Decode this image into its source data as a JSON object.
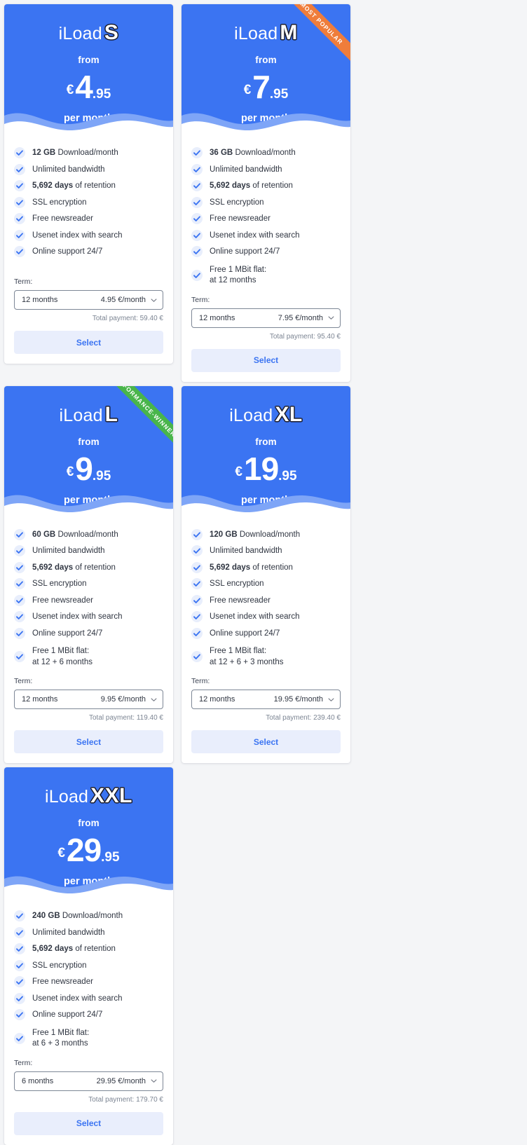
{
  "labels": {
    "brand": "iLoad",
    "from": "from",
    "per_month": "per month",
    "currency": "€",
    "term_label": "Term:",
    "select_button": "Select",
    "check_icon": "check-icon",
    "chevron_icon": "chevron-down-icon"
  },
  "ribbons": {
    "most_popular": "MOST POPULAR",
    "performance_winner": "PERFORMANCE-WINNER"
  },
  "colors": {
    "brand_blue": "#3b74f2",
    "wave_light": "#7ea5f7",
    "ribbon_orange": "#ef7d3b",
    "ribbon_green": "#49b54b",
    "button_bg": "#e9eefc",
    "page_bg": "#f4f5f7"
  },
  "plans": [
    {
      "size": "S",
      "price_int": "4",
      "price_dec": ".95",
      "ribbon": null,
      "features": [
        {
          "bold": "12 GB",
          "text": " Download/month"
        },
        {
          "bold": "",
          "text": "Unlimited bandwidth"
        },
        {
          "bold": "5,692 days",
          "text": " of retention"
        },
        {
          "bold": "",
          "text": "SSL encryption"
        },
        {
          "bold": "",
          "text": "Free newsreader"
        },
        {
          "bold": "",
          "text": "Usenet index with search"
        },
        {
          "bold": "",
          "text": "Online support 24/7"
        }
      ],
      "extra": null,
      "term_months": "12 months",
      "term_rate": "4.95 €/month",
      "total": "Total payment: 59.40 €"
    },
    {
      "size": "M",
      "price_int": "7",
      "price_dec": ".95",
      "ribbon": "most_popular",
      "features": [
        {
          "bold": "36 GB",
          "text": " Download/month"
        },
        {
          "bold": "",
          "text": "Unlimited bandwidth"
        },
        {
          "bold": "5,692 days",
          "text": " of retention"
        },
        {
          "bold": "",
          "text": "SSL encryption"
        },
        {
          "bold": "",
          "text": "Free newsreader"
        },
        {
          "bold": "",
          "text": "Usenet index with search"
        },
        {
          "bold": "",
          "text": "Online support 24/7"
        }
      ],
      "extra": {
        "line1": "Free 1 MBit flat:",
        "line2": "at 12 months"
      },
      "term_months": "12 months",
      "term_rate": "7.95 €/month",
      "total": "Total payment: 95.40 €"
    },
    {
      "size": "L",
      "price_int": "9",
      "price_dec": ".95",
      "ribbon": "performance_winner",
      "features": [
        {
          "bold": "60 GB",
          "text": " Download/month"
        },
        {
          "bold": "",
          "text": "Unlimited bandwidth"
        },
        {
          "bold": "5,692 days",
          "text": " of retention"
        },
        {
          "bold": "",
          "text": "SSL encryption"
        },
        {
          "bold": "",
          "text": "Free newsreader"
        },
        {
          "bold": "",
          "text": "Usenet index with search"
        },
        {
          "bold": "",
          "text": "Online support 24/7"
        }
      ],
      "extra": {
        "line1": "Free 1 MBit flat:",
        "line2": "at 12 + 6 months"
      },
      "term_months": "12 months",
      "term_rate": "9.95 €/month",
      "total": "Total payment: 119.40 €"
    },
    {
      "size": "XL",
      "price_int": "19",
      "price_dec": ".95",
      "ribbon": null,
      "features": [
        {
          "bold": "120 GB",
          "text": " Download/month"
        },
        {
          "bold": "",
          "text": "Unlimited bandwidth"
        },
        {
          "bold": "5,692 days",
          "text": " of retention"
        },
        {
          "bold": "",
          "text": "SSL encryption"
        },
        {
          "bold": "",
          "text": "Free newsreader"
        },
        {
          "bold": "",
          "text": "Usenet index with search"
        },
        {
          "bold": "",
          "text": "Online support 24/7"
        }
      ],
      "extra": {
        "line1": "Free 1 MBit flat:",
        "line2": "at 12 + 6 + 3 months"
      },
      "term_months": "12 months",
      "term_rate": "19.95 €/month",
      "total": "Total payment: 239.40 €"
    },
    {
      "size": "XXL",
      "price_int": "29",
      "price_dec": ".95",
      "ribbon": null,
      "features": [
        {
          "bold": "240 GB",
          "text": " Download/month"
        },
        {
          "bold": "",
          "text": "Unlimited bandwidth"
        },
        {
          "bold": "5,692 days",
          "text": " of retention"
        },
        {
          "bold": "",
          "text": "SSL encryption"
        },
        {
          "bold": "",
          "text": "Free newsreader"
        },
        {
          "bold": "",
          "text": "Usenet index with search"
        },
        {
          "bold": "",
          "text": "Online support 24/7"
        }
      ],
      "extra": {
        "line1": "Free 1 MBit flat:",
        "line2": "at 6 + 3 months"
      },
      "term_months": "6 months",
      "term_rate": "29.95 €/month",
      "total": "Total payment: 179.70 €"
    }
  ]
}
